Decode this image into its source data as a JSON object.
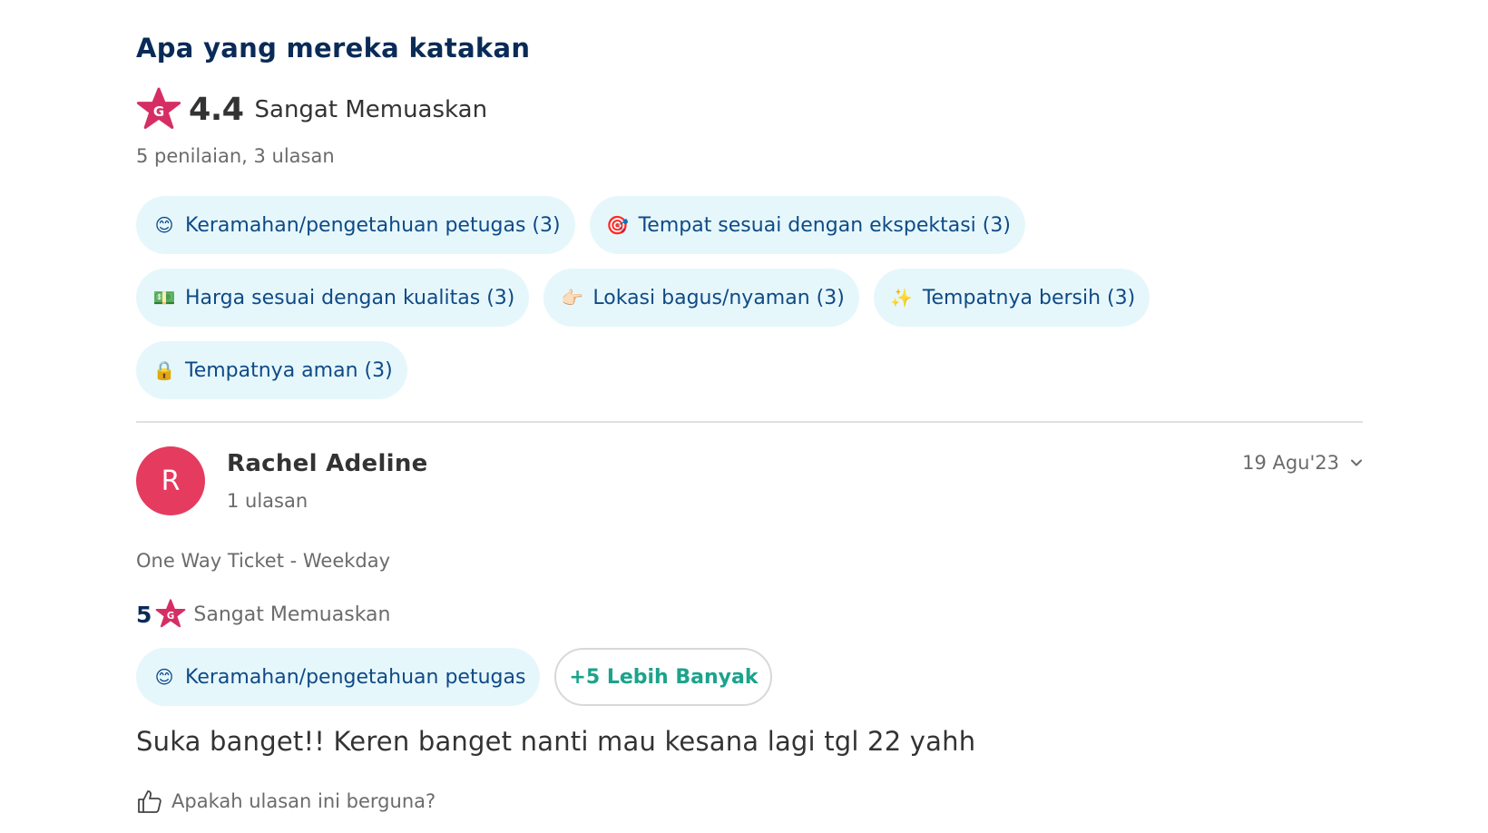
{
  "section": {
    "title": "Apa yang mereka katakan"
  },
  "summary": {
    "rating": "4.4",
    "rating_label": "Sangat Memuaskan",
    "counts": "5 penilaian, 3 ulasan",
    "star_icon": "rating-star-icon",
    "star_color": "#d62e64"
  },
  "highlight_chips": [
    {
      "emoji": "😊",
      "label": "Keramahan/pengetahuan petugas (3)"
    },
    {
      "emoji": "🎯",
      "label": "Tempat sesuai dengan ekspektasi (3)"
    },
    {
      "emoji": "💵",
      "label": "Harga sesuai dengan kualitas (3)"
    },
    {
      "emoji": "👉🏻",
      "label": "Lokasi bagus/nyaman (3)"
    },
    {
      "emoji": "✨",
      "label": "Tempatnya bersih (3)"
    },
    {
      "emoji": "🔒",
      "label": "Tempatnya aman (3)"
    }
  ],
  "review": {
    "avatar_initial": "R",
    "avatar_color": "#e53b5f",
    "name": "Rachel Adeline",
    "review_count": "1 ulasan",
    "date": "19 Agu'23",
    "product": "One Way Ticket - Weekday",
    "score": "5",
    "score_label": "Sangat Memuaskan",
    "tag": {
      "emoji": "😊",
      "label": "Keramahan/pengetahuan petugas"
    },
    "more_label": "+5 Lebih Banyak",
    "text": "Suka banget!! Keren banget nanti mau kesana lagi tgl 22 yahh",
    "helpful_label": "Apakah ulasan ini berguna?"
  },
  "colors": {
    "heading": "#0a2b57",
    "chip_bg": "#e6f7fc",
    "chip_text": "#0f4a86",
    "accent_green": "#1ba38c"
  }
}
